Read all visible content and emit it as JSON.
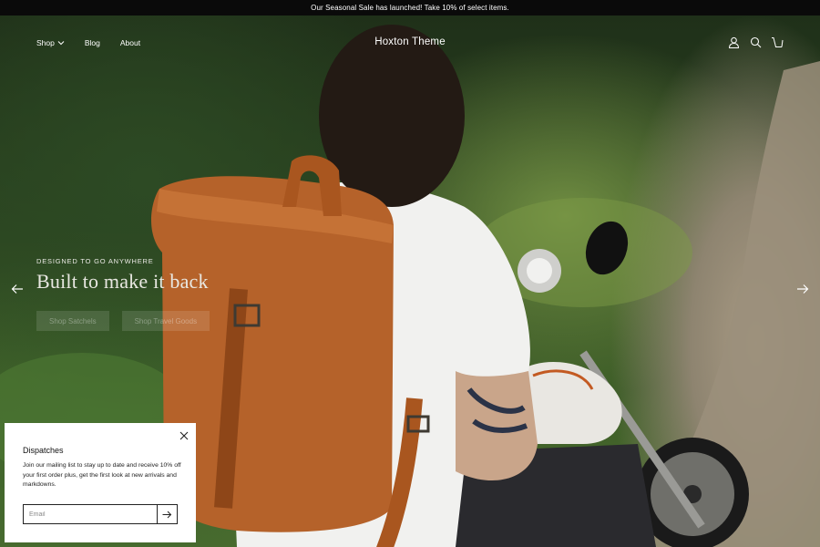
{
  "announcement": {
    "text": "Our Seasonal Sale has launched! Take 10% of select items."
  },
  "header": {
    "nav": [
      {
        "label": "Shop",
        "has_dropdown": true
      },
      {
        "label": "Blog"
      },
      {
        "label": "About"
      }
    ],
    "logo": "Hoxton Theme",
    "icons": [
      "account-icon",
      "search-icon",
      "cart-icon"
    ]
  },
  "hero": {
    "eyebrow": "DESIGNED TO GO ANYWHERE",
    "headline": "Built to make it back",
    "buttons": [
      "Shop Satchels",
      "Shop Travel Goods"
    ]
  },
  "popup": {
    "title": "Dispatches",
    "text": "Join our mailing list to stay up to date and receive 10% off your first order plus, get the first look at new arrivals and markdowns.",
    "email_placeholder": "Email"
  },
  "colors": {
    "announcement_bg": "#0a0a0a",
    "foliage": "#2b4520",
    "bag_leather": "#b5622a",
    "popup_bg": "#ffffff"
  }
}
